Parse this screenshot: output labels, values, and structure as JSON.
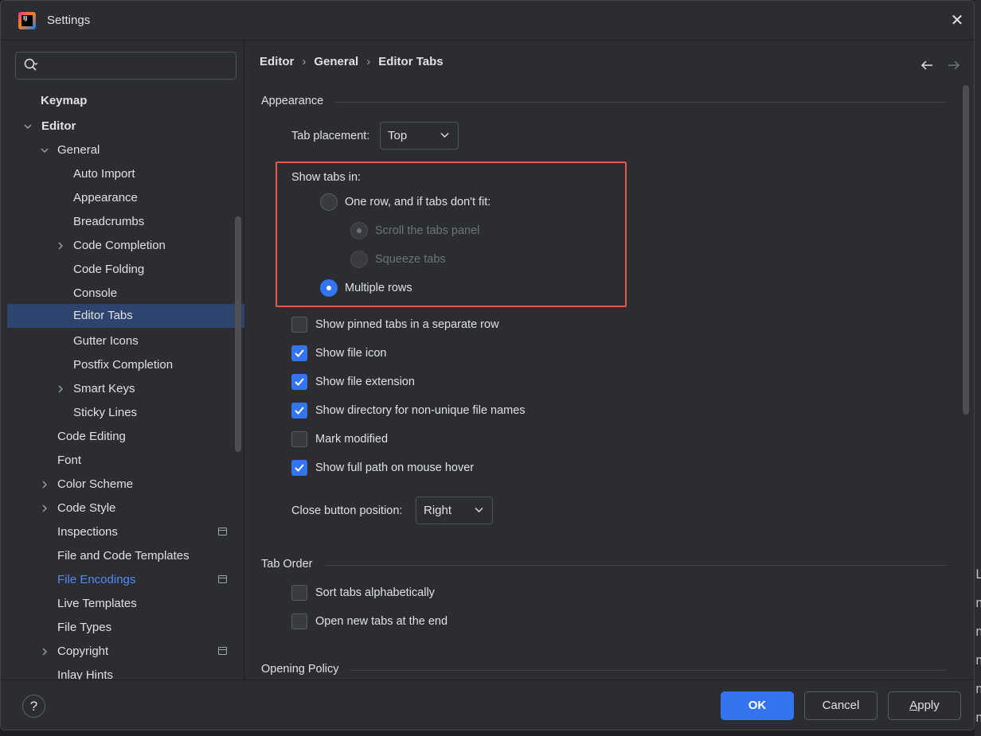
{
  "window": {
    "title": "Settings",
    "close_symbol": "✕"
  },
  "search": {
    "placeholder": "",
    "value": ""
  },
  "sidebar": {
    "items": [
      {
        "label": "Keymap"
      },
      {
        "label": "Editor"
      },
      {
        "label": "General"
      },
      {
        "label": "Auto Import"
      },
      {
        "label": "Appearance"
      },
      {
        "label": "Breadcrumbs"
      },
      {
        "label": "Code Completion"
      },
      {
        "label": "Code Folding"
      },
      {
        "label": "Console"
      },
      {
        "label": "Editor Tabs"
      },
      {
        "label": "Gutter Icons"
      },
      {
        "label": "Postfix Completion"
      },
      {
        "label": "Smart Keys"
      },
      {
        "label": "Sticky Lines"
      },
      {
        "label": "Code Editing"
      },
      {
        "label": "Font"
      },
      {
        "label": "Color Scheme"
      },
      {
        "label": "Code Style"
      },
      {
        "label": "Inspections"
      },
      {
        "label": "File and Code Templates"
      },
      {
        "label": "File Encodings"
      },
      {
        "label": "Live Templates"
      },
      {
        "label": "File Types"
      },
      {
        "label": "Copyright"
      },
      {
        "label": "Inlay Hints"
      }
    ]
  },
  "breadcrumb": {
    "items": [
      "Editor",
      "General",
      "Editor Tabs"
    ],
    "separator": "›"
  },
  "appearance": {
    "section_title": "Appearance",
    "tab_placement_label": "Tab placement:",
    "tab_placement_value": "Top",
    "show_tabs_in_label": "Show tabs in:",
    "radio_one_row": "One row, and if tabs don't fit:",
    "radio_scroll": "Scroll the tabs panel",
    "radio_squeeze": "Squeeze tabs",
    "radio_multiple": "Multiple rows",
    "cb_pinned": "Show pinned tabs in a separate row",
    "cb_file_icon": "Show file icon",
    "cb_file_ext": "Show file extension",
    "cb_directory": "Show directory for non-unique file names",
    "cb_mark_modified": "Mark modified",
    "cb_full_path": "Show full path on mouse hover",
    "close_button_label": "Close button position:",
    "close_button_value": "Right"
  },
  "tab_order": {
    "section_title": "Tab Order",
    "cb_sort": "Sort tabs alphabetically",
    "cb_open_end": "Open new tabs at the end"
  },
  "opening_policy": {
    "section_title": "Opening Policy"
  },
  "footer": {
    "help": "?",
    "ok": "OK",
    "cancel": "Cancel",
    "apply_first": "A",
    "apply_rest": "pply"
  },
  "colors": {
    "accent": "#3574f0",
    "selection": "#2e436e",
    "highlight_border": "#e05a4f",
    "link": "#548af7",
    "background": "#2b2d30"
  },
  "background_glyphs": [
    "Le",
    "n",
    "n",
    "n",
    "n",
    "n"
  ]
}
